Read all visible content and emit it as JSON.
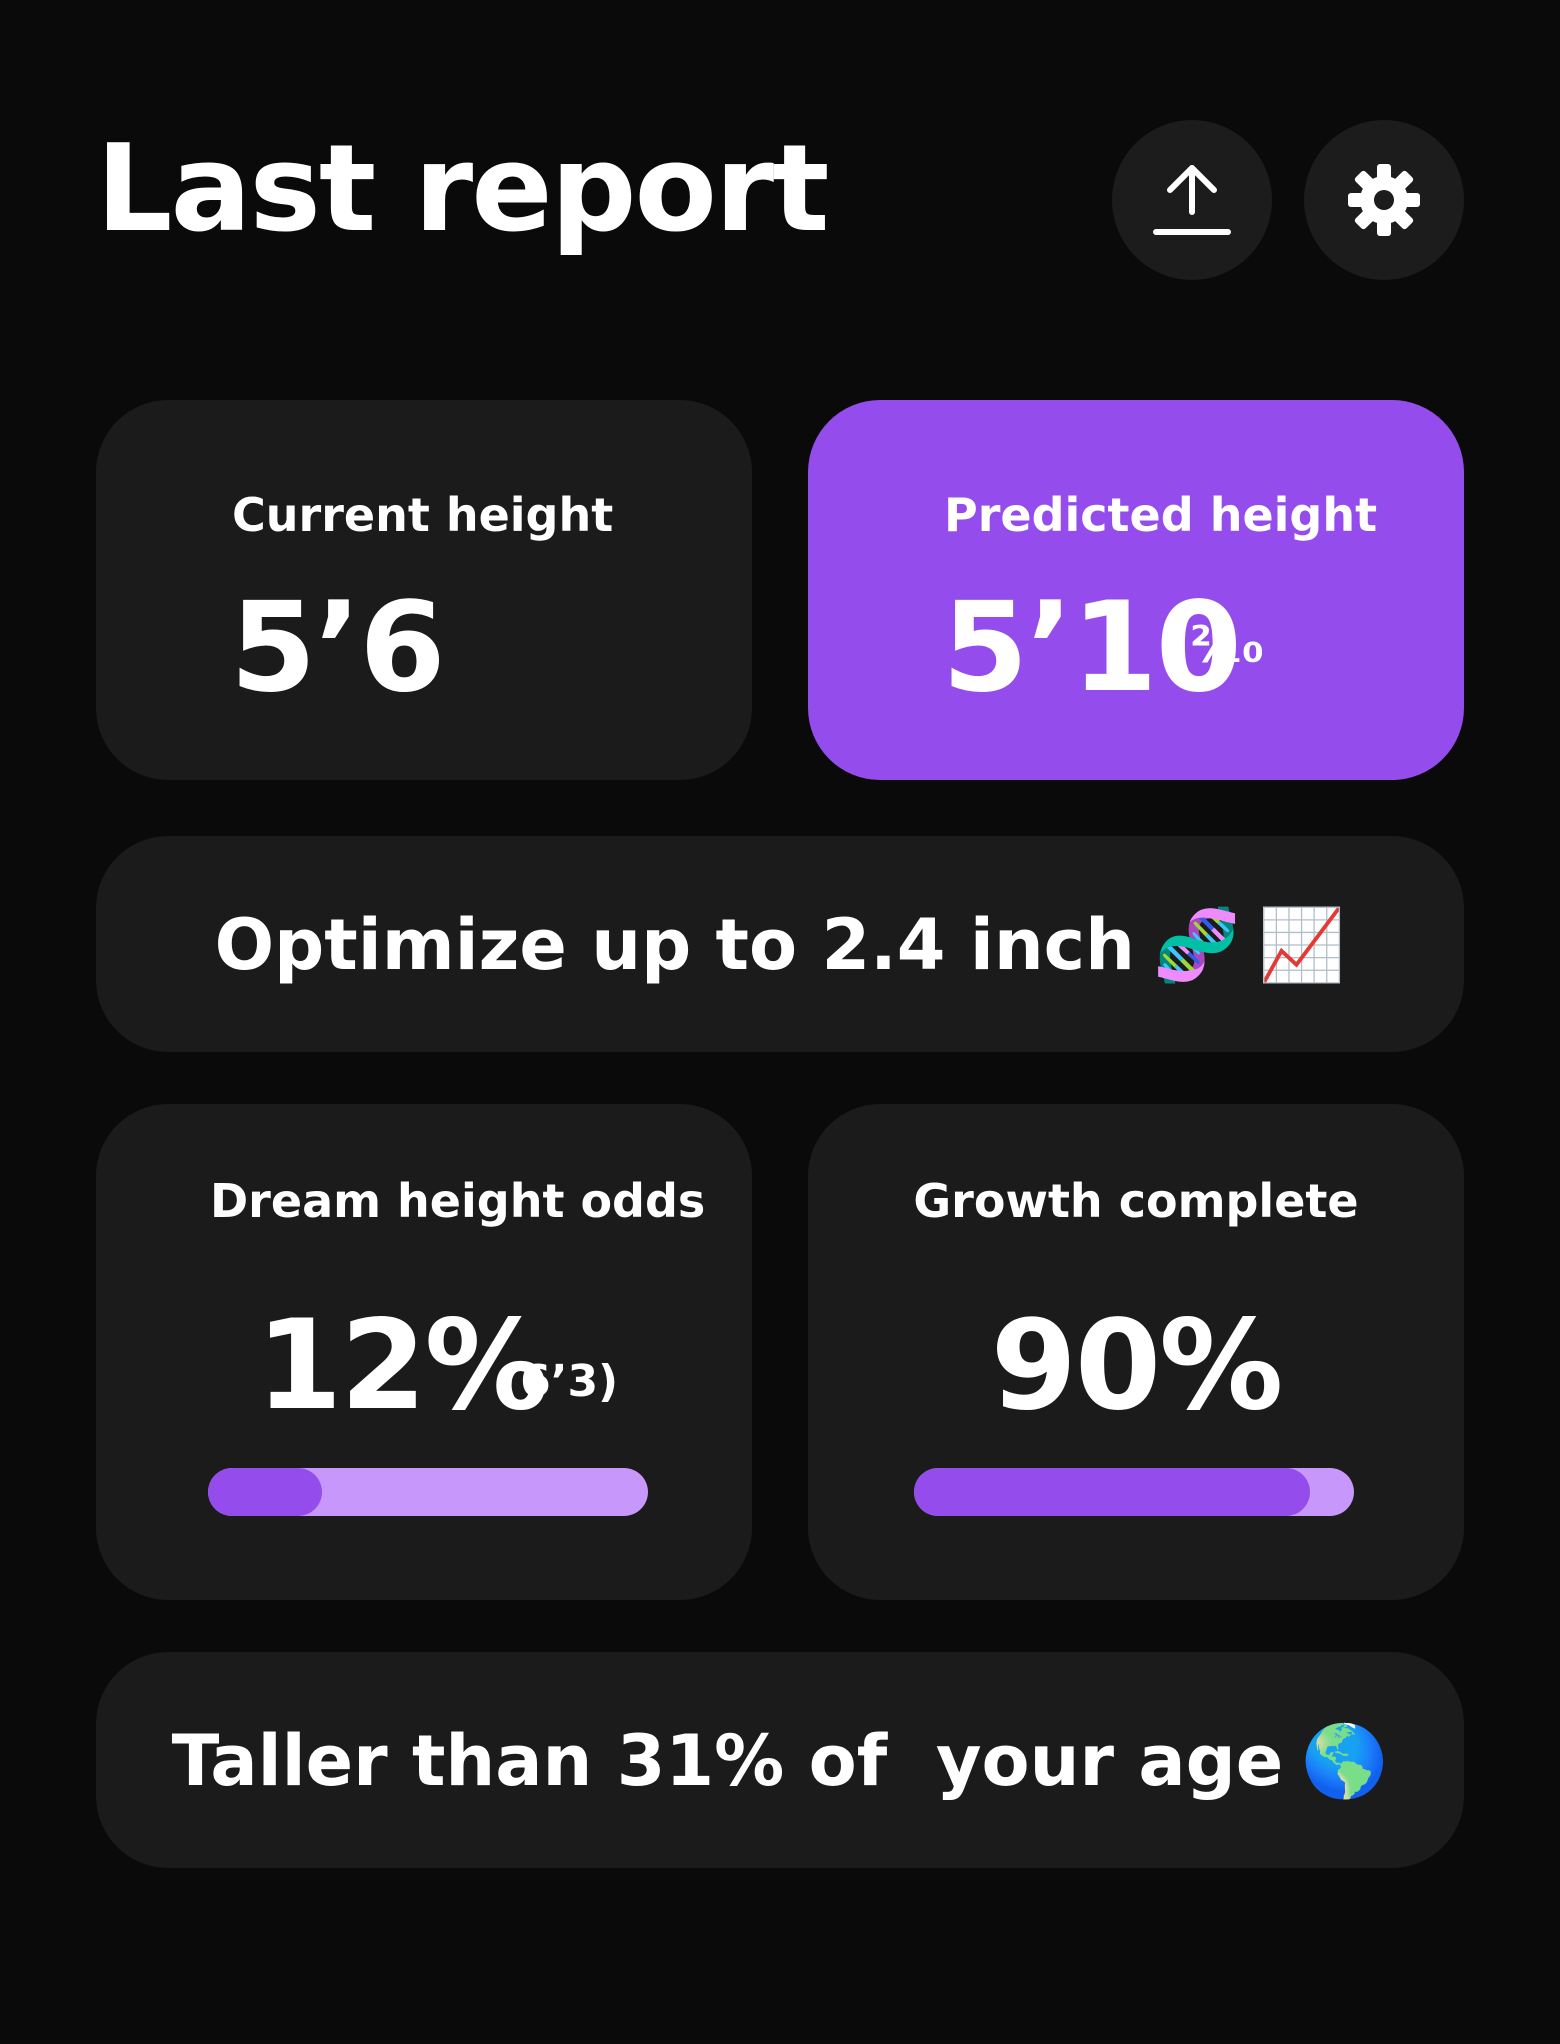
{
  "header": {
    "title": "Last report",
    "upload_icon": "upload-icon",
    "settings_icon": "gear-icon"
  },
  "current_height": {
    "label": "Current height",
    "value": "5’6"
  },
  "predicted_height": {
    "label": "Predicted height",
    "value": "5’10",
    "fraction": "²⁄₁₀"
  },
  "optimize_banner": {
    "text": "Optimize up to 2.4 inch",
    "emojis": [
      "🧬",
      "📈"
    ]
  },
  "dream_odds": {
    "label": "Dream height odds",
    "value": "12%",
    "target": "(6’3)",
    "progress": 0.26
  },
  "growth_complete": {
    "label": "Growth complete",
    "value": "90%",
    "progress": 0.9
  },
  "percentile_banner": {
    "text": "Taller than 31% of  your age",
    "emoji": "🌎"
  },
  "colors": {
    "background": "#0a0a0a",
    "card": "#1b1b1b",
    "accent": "#944ced",
    "bar_track": "#c897fb",
    "text": "#ffffff"
  }
}
